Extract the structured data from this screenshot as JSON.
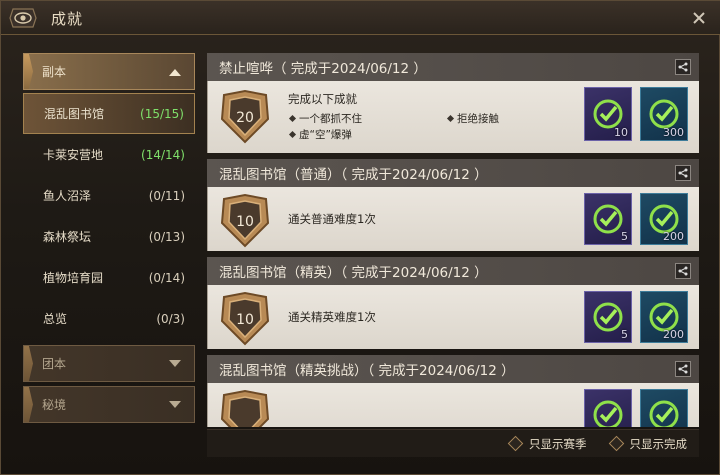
{
  "window": {
    "title": "成就"
  },
  "sidebar": {
    "categories": [
      {
        "label": "副本",
        "expanded": true
      },
      {
        "label": "团本",
        "expanded": false
      },
      {
        "label": "秘境",
        "expanded": false
      }
    ],
    "items": [
      {
        "label": "混乱图书馆",
        "count": "(15/15)",
        "complete": true,
        "selected": true
      },
      {
        "label": "卡莱安营地",
        "count": "(14/14)",
        "complete": true,
        "selected": false
      },
      {
        "label": "鱼人沼泽",
        "count": "(0/11)",
        "complete": false,
        "selected": false
      },
      {
        "label": "森林祭坛",
        "count": "(0/13)",
        "complete": false,
        "selected": false
      },
      {
        "label": "植物培育园",
        "count": "(0/14)",
        "complete": false,
        "selected": false
      },
      {
        "label": "总览",
        "count": "(0/3)",
        "complete": false,
        "selected": false
      }
    ]
  },
  "achievements": [
    {
      "title": "禁止喧哗（ 完成于2024/06/12 ）",
      "points": "20",
      "description": "完成以下成就",
      "criteria": [
        "一个都抓不住",
        "拒绝接触",
        "虚“空”爆弹"
      ],
      "rewards": [
        "10",
        "300"
      ]
    },
    {
      "title": "混乱图书馆（普通）（ 完成于2024/06/12 ）",
      "points": "10",
      "description": "通关普通难度1次",
      "rewards": [
        "5",
        "200"
      ]
    },
    {
      "title": "混乱图书馆（精英）（ 完成于2024/06/12 ）",
      "points": "10",
      "description": "通关精英难度1次",
      "rewards": [
        "5",
        "200"
      ]
    },
    {
      "title": "混乱图书馆（精英挑战）（ 完成于2024/06/12 ）",
      "points": "",
      "description": "",
      "rewards": []
    }
  ],
  "footer": {
    "season_only": "只显示赛季",
    "completed_only": "只显示完成"
  },
  "colors": {
    "complete_count": "#7fe06a",
    "accent_gold": "#a8875a"
  },
  "icons": {
    "title": "eye-emblem-icon",
    "close": "close-icon",
    "share": "share-icon",
    "reward": "check-circle-icon"
  }
}
